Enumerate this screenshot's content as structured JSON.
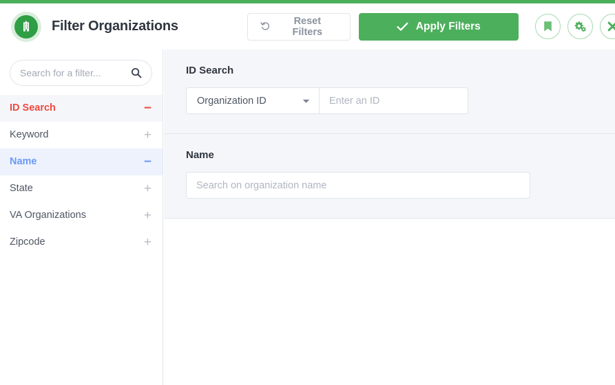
{
  "theme": {
    "accent_green": "#4caf5c",
    "panel_bg": "#f5f6fa",
    "active_red": "#f0483e",
    "active_blue": "#6b9af5",
    "text_dark": "#2f3640"
  },
  "header": {
    "logo_icon": "organization-building-icon",
    "title": "Filter Organizations",
    "reset_label": "Reset Filters",
    "reset_icon": "undo-arrow-icon",
    "apply_label": "Apply Filters",
    "apply_icon": "check-icon",
    "icon_buttons": [
      {
        "name": "bookmark-icon",
        "title": "Bookmark"
      },
      {
        "name": "gears-icon",
        "title": "Settings"
      },
      {
        "name": "close-icon",
        "title": "Close"
      }
    ]
  },
  "sidebar": {
    "search": {
      "placeholder": "Search for a filter...",
      "value": "",
      "icon": "search-icon"
    },
    "items": [
      {
        "label": "ID Search",
        "toggle": "−",
        "state": "expanded-red"
      },
      {
        "label": "Keyword",
        "toggle": "+",
        "state": "collapsed"
      },
      {
        "label": "Name",
        "toggle": "−",
        "state": "expanded-blue"
      },
      {
        "label": "State",
        "toggle": "+",
        "state": "collapsed"
      },
      {
        "label": "VA Organizations",
        "toggle": "+",
        "state": "collapsed"
      },
      {
        "label": "Zipcode",
        "toggle": "+",
        "state": "collapsed"
      }
    ]
  },
  "main": {
    "sections": [
      {
        "title": "ID Search",
        "select": {
          "value": "Organization ID",
          "icon": "chevron-down-icon"
        },
        "input": {
          "placeholder": "Enter an ID",
          "value": ""
        }
      },
      {
        "title": "Name",
        "input": {
          "placeholder": "Search on organization name",
          "value": ""
        }
      }
    ]
  }
}
